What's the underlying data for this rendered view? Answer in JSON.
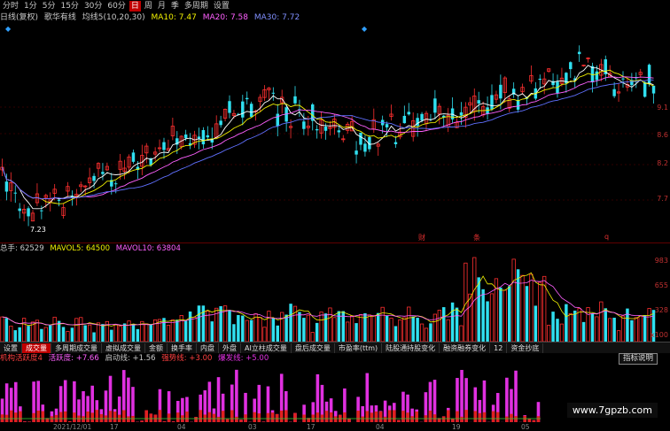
{
  "toolbar": {
    "periods": [
      "分时",
      "1分",
      "5分",
      "15分",
      "30分",
      "60分",
      "日",
      "周",
      "月",
      "季",
      "多周期",
      "设置"
    ],
    "active_period": "日"
  },
  "info": {
    "mode": "日线(复权)",
    "indicator_name": "歌华有线",
    "ma_group": "均线5(10,20,30)",
    "ma10": "MA10: 7.47",
    "ma20": "MA20: 7.58",
    "ma30": "MA30: 7.72"
  },
  "price_axis": [
    "9.1",
    "8.6",
    "8.2",
    "7.7"
  ],
  "low_marker": "7.23",
  "event_markers": [
    "财",
    "条",
    "q"
  ],
  "volume": {
    "total": "总手: 62529",
    "mavol5": "MAVOL5: 64500",
    "mavol10": "MAVOL10: 63804",
    "axis": [
      "983",
      "655",
      "328",
      "x100"
    ]
  },
  "tabs": [
    "设置",
    "成交量",
    "多周期成交量",
    "虚拟成交量",
    "金额",
    "换手率",
    "内盘",
    "外盘",
    "AI立柱成交量",
    "盘后成交量",
    "市盈率(ttm)",
    "陆股通持股变化",
    "融资融券变化",
    "12",
    "资金抄底"
  ],
  "active_tab": "成交量",
  "indicator_line": {
    "name": "机构活跃度4",
    "active_label": "活跃度: +7.66",
    "start_label": "启动线: +1.56",
    "strong_label": "强势线: +3.00",
    "hot_label": "爆发线: +5.00"
  },
  "help_button": "指标说明",
  "date_axis": [
    "2021/12/01",
    "17",
    "04",
    "03",
    "17",
    "04",
    "19",
    "05"
  ],
  "watermark": "www.7gpzb.com",
  "colors": {
    "up": "#ff3030",
    "down": "#30e0f0",
    "ma5": "#ffffff",
    "ma10": "#f0f000",
    "ma20": "#ff60ff",
    "ma30": "#6070ff",
    "active_bg": "#c00000",
    "indicator_bar": "#e030e0"
  }
}
